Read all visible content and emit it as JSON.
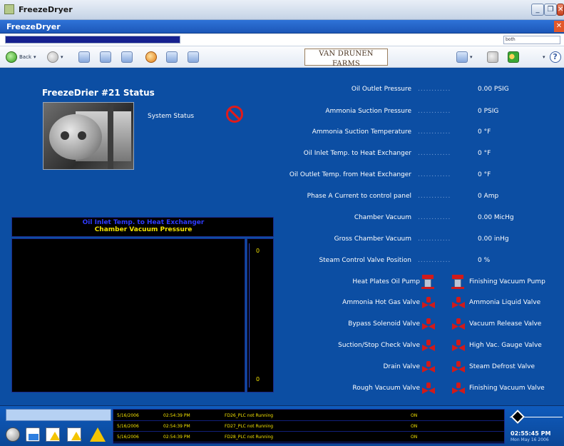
{
  "window": {
    "title": "FreezeDryer",
    "minimize": "_",
    "restore": "❐",
    "close": "✕"
  },
  "inner_header": {
    "title": "FreezeDryer",
    "close": "✕"
  },
  "address": {
    "search_text": "both",
    "progress": 1.0
  },
  "toolbar": {
    "back_label": "Back",
    "logo_text": "VAN DRUNEN FARMS"
  },
  "panel": {
    "title": "FreezeDrier #21 Status",
    "system_status_label": "System Status"
  },
  "readings": [
    {
      "label": "Oil Outlet Pressure",
      "value": "0.00 PSIG"
    },
    {
      "label": "Ammonia Suction Pressure",
      "value": "0 PSIG"
    },
    {
      "label": "Ammonia Suction Temperature",
      "value": "0 °F"
    },
    {
      "label": "Oil Inlet Temp. to Heat Exchanger",
      "value": "0 °F"
    },
    {
      "label": "Oil Outlet Temp. from Heat Exchanger",
      "value": "0 °F"
    },
    {
      "label": "Phase A Current to control panel",
      "value": "0 Amp"
    },
    {
      "label": "Chamber Vacuum",
      "value": "0.00 MicHg"
    },
    {
      "label": "Gross Chamber Vacuum",
      "value": "0.00 inHg"
    },
    {
      "label": "Steam Control Valve Position",
      "value": "0 %"
    }
  ],
  "dots": "............",
  "chart": {
    "title": "Oil Inlet Temp. to Heat Exchanger",
    "subtitle": "Chamber Vacuum Pressure",
    "tick_top": "0",
    "tick_bottom": "0"
  },
  "chart_data": {
    "type": "line",
    "title": "Oil Inlet Temp. to Heat Exchanger",
    "subtitle": "Chamber Vacuum Pressure",
    "series": [],
    "y_ticks": [
      "0",
      "0"
    ]
  },
  "equipment": [
    {
      "left_label": "Heat Plates Oil Pump",
      "left_type": "pump",
      "right_label": "Finishing Vacuum Pump",
      "right_type": "pump"
    },
    {
      "left_label": "Ammonia Hot Gas Valve",
      "left_type": "valve",
      "right_label": "Ammonia Liquid Valve",
      "right_type": "valve"
    },
    {
      "left_label": "Bypass Solenoid Valve",
      "left_type": "valve",
      "right_label": "Vacuum Release Valve",
      "right_type": "valve"
    },
    {
      "left_label": "Suction/Stop Check Valve",
      "left_type": "valve",
      "right_label": "High Vac. Gauge Valve",
      "right_type": "valve"
    },
    {
      "left_label": "Drain Valve",
      "left_type": "valve",
      "right_label": "Steam Defrost Valve",
      "right_type": "valve"
    },
    {
      "left_label": "Rough Vacuum Valve",
      "left_type": "valve",
      "right_label": "Finishing Vacuum Valve",
      "right_type": "valve"
    }
  ],
  "alarms": [
    {
      "date": "5/16/2006",
      "time": "02:54:39 PM",
      "message": "FD26_PLC not Running",
      "state": "ON"
    },
    {
      "date": "5/16/2006",
      "time": "02:54:39 PM",
      "message": "FD27_PLC not Running",
      "state": "ON"
    },
    {
      "date": "5/16/2006",
      "time": "02:54:39 PM",
      "message": "FD28_PLC not Running",
      "state": "ON"
    }
  ],
  "clock": {
    "time": "02:55:45 PM",
    "date": "Mon May 16 2006"
  },
  "colors": {
    "panel_bg": "#0c4ea3",
    "chart_title": "#2f3bff",
    "chart_subtitle": "#f5e400",
    "alarm_text": "#f5e400",
    "valve_red": "#d11a1a"
  }
}
